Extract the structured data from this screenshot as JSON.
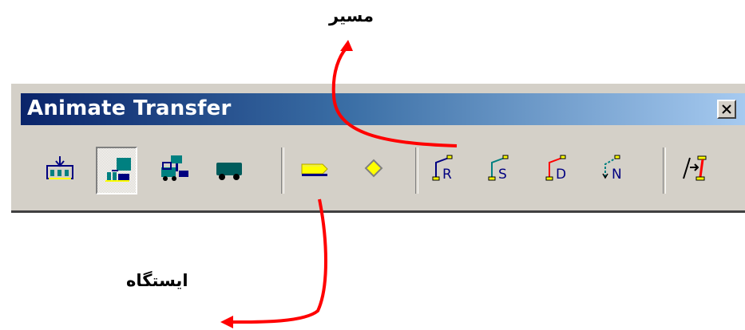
{
  "window": {
    "title": "Animate Transfer",
    "close_symbol": "×"
  },
  "toolbar": {
    "buttons": [
      {
        "icon": "station-array-icon",
        "pressed": false
      },
      {
        "icon": "station-pickup-icon",
        "pressed": true
      },
      {
        "icon": "forklift-icon",
        "pressed": false
      },
      {
        "icon": "transporter-icon",
        "pressed": false
      },
      {
        "icon": "storage-station-icon",
        "pressed": false
      },
      {
        "icon": "intersection-diamond-icon",
        "pressed": false
      },
      {
        "icon": "route-icon",
        "letter": "R",
        "pressed": false
      },
      {
        "icon": "segment-icon",
        "letter": "S",
        "pressed": false
      },
      {
        "icon": "distance-icon",
        "letter": "D",
        "pressed": false
      },
      {
        "icon": "network-icon",
        "letter": "N",
        "pressed": false
      },
      {
        "icon": "promote-path-icon",
        "pressed": false
      }
    ]
  },
  "annotations": {
    "path_label": "مسیر",
    "station_label": "ایستگاه",
    "arrow_color": "#ff0000"
  },
  "colors": {
    "teal": "#008080",
    "navy": "#000080",
    "yellow": "#ffff00",
    "red": "#ff0000",
    "title_start": "#0a246a",
    "title_end": "#a6caf0",
    "face": "#d4d0c8"
  }
}
